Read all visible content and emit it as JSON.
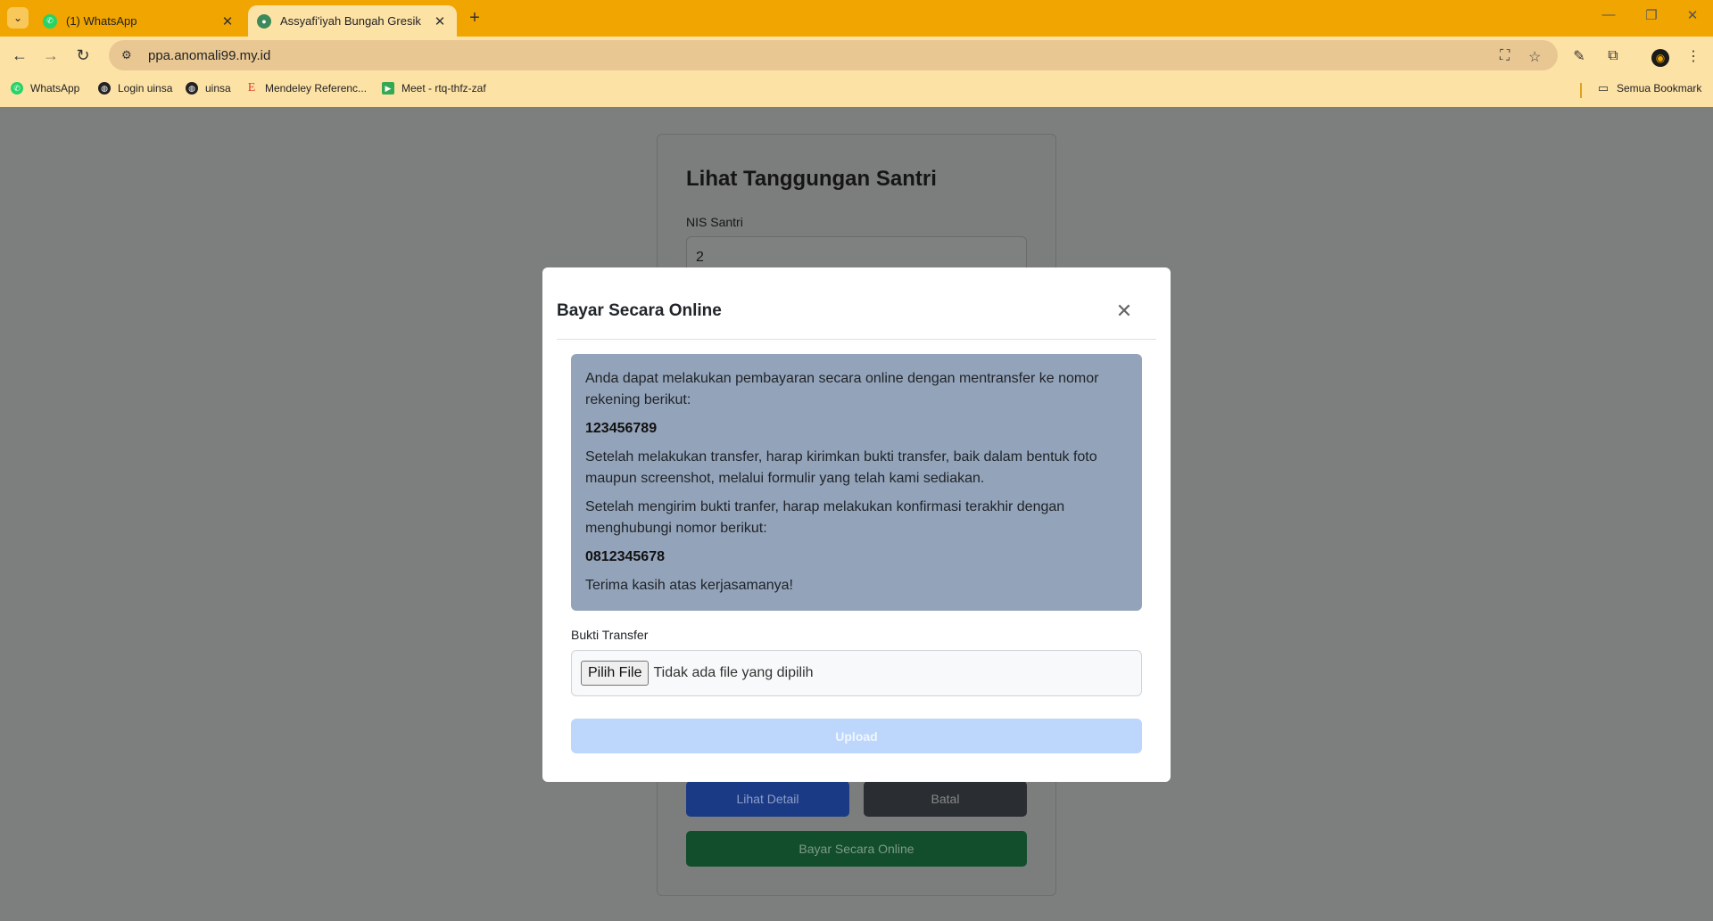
{
  "browser": {
    "tabs": [
      {
        "label": "(1) WhatsApp",
        "icon": "whatsapp-icon",
        "active": false
      },
      {
        "label": "Assyafi'iyah Bungah Gresik",
        "icon": "site-logo-icon",
        "active": true
      }
    ],
    "url": "ppa.anomali99.my.id",
    "bookmarks": [
      {
        "label": "WhatsApp",
        "icon": "whatsapp-icon"
      },
      {
        "label": "Login uinsa",
        "icon": "globe-icon"
      },
      {
        "label": "uinsa",
        "icon": "globe-icon"
      },
      {
        "label": "Mendeley Referenc...",
        "icon": "mendeley-icon"
      },
      {
        "label": "Meet - rtq-thfz-zaf",
        "icon": "meet-icon"
      }
    ],
    "all_bookmarks": "Semua Bookmark",
    "accent_color": "#f0a500"
  },
  "page": {
    "title": "Lihat Tanggungan Santri",
    "nis_label": "NIS Santri",
    "nis_value": "2",
    "detail_button": "Lihat Detail",
    "cancel_button": "Batal",
    "online_button": "Bayar Secara Online"
  },
  "modal": {
    "title": "Bayar Secara Online",
    "intro": "Anda dapat melakukan pembayaran secara online dengan mentransfer ke nomor rekening berikut:",
    "account_number": "123456789",
    "instruction": "Setelah melakukan transfer, harap kirimkan bukti transfer, baik dalam bentuk foto maupun screenshot, melalui formulir yang telah kami sediakan.",
    "confirm_text": "Setelah mengirim bukti tranfer, harap melakukan konfirmasi terakhir dengan menghubungi nomor berikut:",
    "phone_number": "0812345678",
    "thanks": "Terima kasih atas kerjasamanya!",
    "file_label": "Bukti Transfer",
    "file_button": "Pilih File",
    "file_status": "Tidak ada file yang dipilih",
    "upload_button": "Upload"
  }
}
